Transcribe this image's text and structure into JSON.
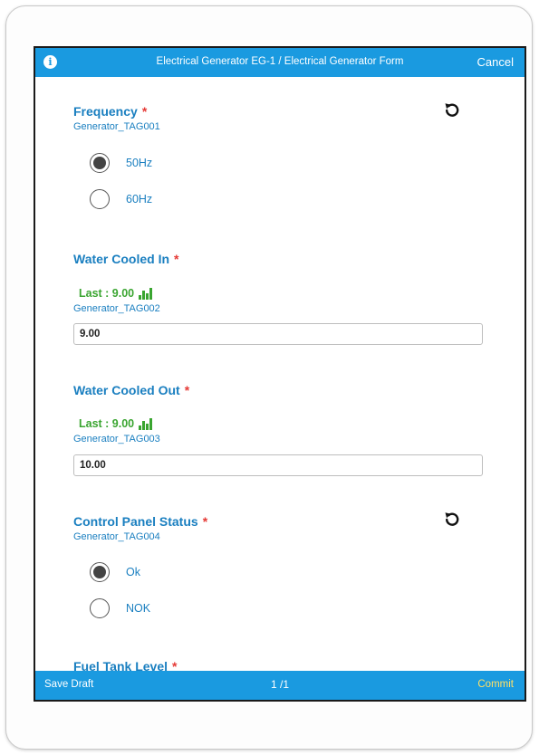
{
  "header": {
    "title": "Electrical Generator EG-1 / Electrical Generator Form",
    "cancel_label": "Cancel",
    "info_icon": "i"
  },
  "questions": {
    "frequency": {
      "title": "Frequency",
      "required_mark": "*",
      "tag": "Generator_TAG001",
      "options": [
        "50Hz",
        "60Hz"
      ],
      "selected": "50Hz"
    },
    "water_in": {
      "title": "Water Cooled In",
      "required_mark": "*",
      "last": "Last : 9.00",
      "tag": "Generator_TAG002",
      "value": "9.00"
    },
    "water_out": {
      "title": "Water Cooled Out",
      "required_mark": "*",
      "last": "Last : 9.00",
      "tag": "Generator_TAG003",
      "value": "10.00"
    },
    "control_panel": {
      "title": "Control Panel Status",
      "required_mark": "*",
      "tag": "Generator_TAG004",
      "options": [
        "Ok",
        "NOK"
      ],
      "selected": "Ok"
    },
    "fuel_tank": {
      "title": "Fuel Tank Level",
      "required_mark": "*"
    }
  },
  "footer": {
    "save_draft_label": "Save Draft",
    "page_indicator": "1 /1",
    "commit_label": "Commit"
  },
  "colors": {
    "bar_blue": "#1a9ae0",
    "title_blue": "#1a7fc0",
    "required_red": "#e53935",
    "last_green": "#3aa530",
    "commit_yellow": "#ffe066"
  }
}
